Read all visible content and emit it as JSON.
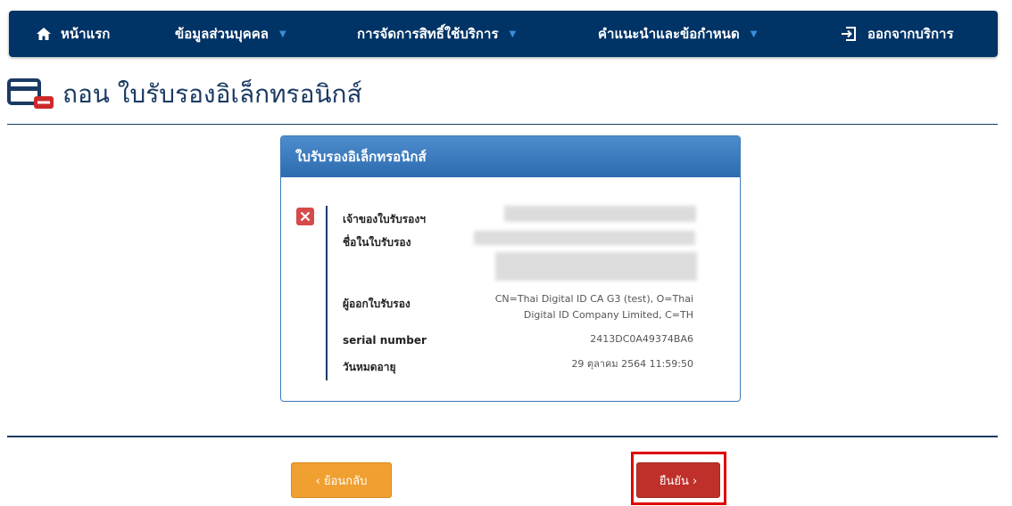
{
  "nav": {
    "home": "หน้าแรก",
    "personal": "ข้อมูลส่วนบุคคล",
    "rights": "การจัดการสิทธิ์ใช้บริการ",
    "guide": "คำแนะนำและข้อกำหนด",
    "logout": "ออกจากบริการ"
  },
  "page": {
    "title": "ถอน ใบรับรองอิเล็กทรอนิกส์"
  },
  "panel": {
    "heading": "ใบรับรองอิเล็กทรอนิกส์",
    "owner_label": "เจ้าของใบรับรองฯ",
    "name_label": "ชื่อในใบรับรอง",
    "issuer_label": "ผู้ออกใบรับรอง",
    "issuer_line1": "CN=Thai Digital ID CA G3 (test), O=Thai",
    "issuer_line2": "Digital ID Company Limited, C=TH",
    "serial_label": "serial number",
    "serial_value": "2413DC0A49374BA6",
    "expiry_label": "วันหมดอายุ",
    "expiry_value": "29 ตุลาคม 2564 11:59:50"
  },
  "buttons": {
    "back": "‹ ย้อนกลับ",
    "confirm": "ยืนยัน ›"
  },
  "colors": {
    "navbar": "#003366",
    "panel_header": "#3a7bbf",
    "back_button": "#f0a030",
    "confirm_button": "#c0302a",
    "highlight": "#e00000"
  }
}
